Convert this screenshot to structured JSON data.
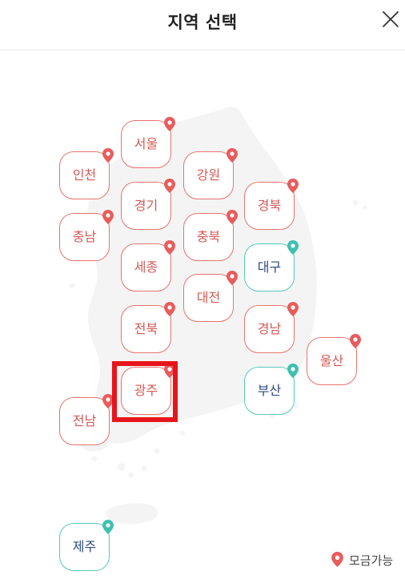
{
  "header": {
    "title": "지역 선택",
    "close_icon": "close-icon"
  },
  "colors": {
    "pin_red": "#e85c5c",
    "pin_teal": "#3fc0b1",
    "border_red": "#e8736e",
    "border_teal": "#56c8bb",
    "label_red": "#d45a55",
    "label_navy": "#2f4a7a",
    "selection": "#e8141b",
    "map_fill": "#f4f4f4"
  },
  "regions": [
    {
      "id": "seoul",
      "label": "서울",
      "status": "fundraising"
    },
    {
      "id": "incheon",
      "label": "인천",
      "status": "fundraising"
    },
    {
      "id": "gangwon",
      "label": "강원",
      "status": "fundraising"
    },
    {
      "id": "gyeonggi",
      "label": "경기",
      "status": "fundraising"
    },
    {
      "id": "gyeongbuk",
      "label": "경북",
      "status": "fundraising"
    },
    {
      "id": "chungnam",
      "label": "충남",
      "status": "fundraising"
    },
    {
      "id": "chungbuk",
      "label": "충북",
      "status": "fundraising"
    },
    {
      "id": "sejong",
      "label": "세종",
      "status": "fundraising"
    },
    {
      "id": "daegu",
      "label": "대구",
      "status": "available"
    },
    {
      "id": "daejeon",
      "label": "대전",
      "status": "fundraising"
    },
    {
      "id": "jeonbuk",
      "label": "전북",
      "status": "fundraising"
    },
    {
      "id": "gyeongnam",
      "label": "경남",
      "status": "fundraising"
    },
    {
      "id": "ulsan",
      "label": "울산",
      "status": "fundraising"
    },
    {
      "id": "gwangju",
      "label": "광주",
      "status": "fundraising",
      "selected": true
    },
    {
      "id": "busan",
      "label": "부산",
      "status": "available"
    },
    {
      "id": "jeonnam",
      "label": "전남",
      "status": "fundraising"
    },
    {
      "id": "jeju",
      "label": "제주",
      "status": "available"
    }
  ],
  "legend": {
    "label": "모금가능",
    "icon": "map-pin-icon"
  }
}
